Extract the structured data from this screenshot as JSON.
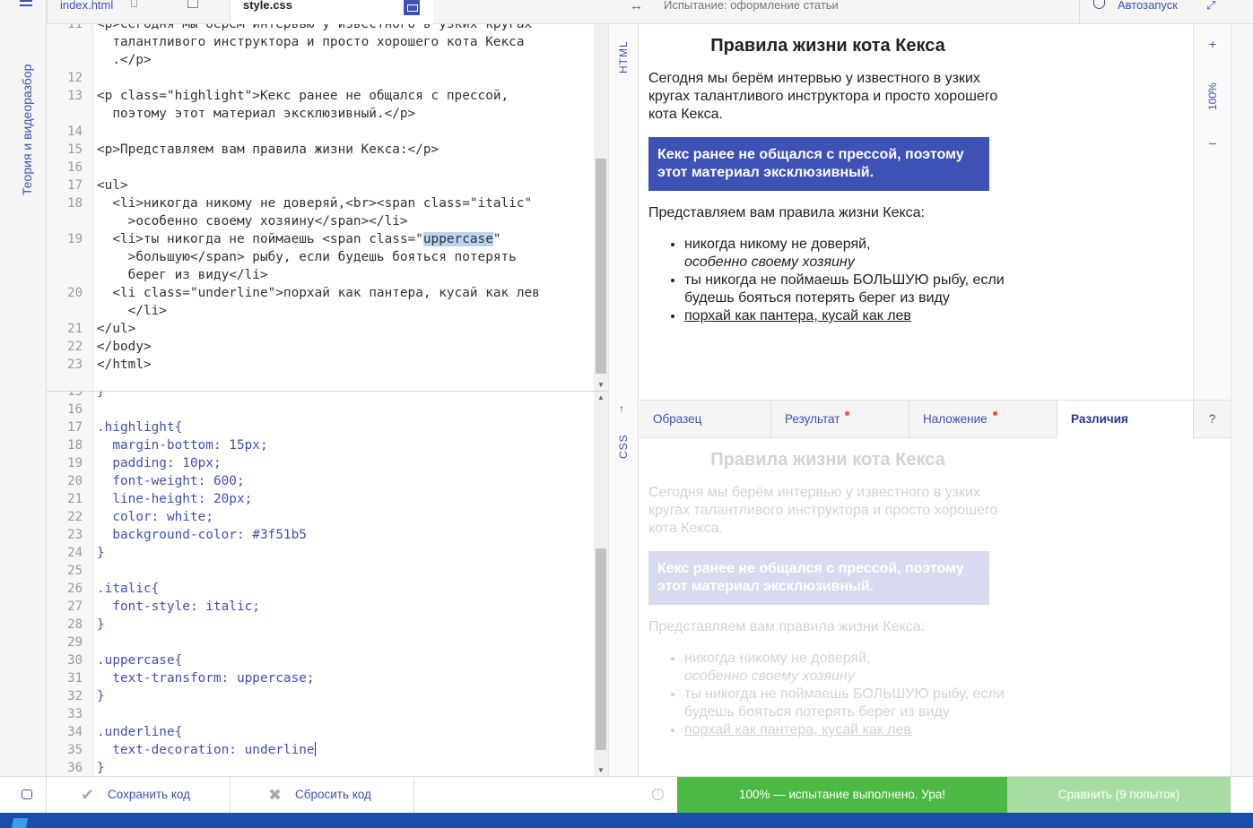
{
  "sidebar": {
    "label": "Теория и видеоразбор"
  },
  "editor_tabs": {
    "index": "index.html",
    "style": "style.css"
  },
  "html_editor": {
    "label": "HTML",
    "lines": [
      {
        "n": "11",
        "t": "<p>Сегодня мы берём интервью у известного в узких кругах"
      },
      {
        "n": "",
        "t": "  талантливого инструктора и просто хорошего кота Кекса"
      },
      {
        "n": "",
        "t": "  .</p>"
      },
      {
        "n": "12",
        "t": ""
      },
      {
        "n": "13",
        "t": "<p class=\"highlight\">Кекс ранее не общался с прессой,"
      },
      {
        "n": "",
        "t": "  поэтому этот материал эксклюзивный.</p>"
      },
      {
        "n": "14",
        "t": ""
      },
      {
        "n": "15",
        "t": "<p>Представляем вам правила жизни Кекса:</p>"
      },
      {
        "n": "16",
        "t": ""
      },
      {
        "n": "17",
        "t": "<ul>"
      },
      {
        "n": "18",
        "t": "  <li>никогда никому не доверяй,<br><span class=\"italic\""
      },
      {
        "n": "",
        "t": "    >особенно своему хозяину</span></li>"
      },
      {
        "n": "19",
        "t": "  <li>ты никогда не поймаешь <span class=\"",
        "hl": "uppercase",
        "after": "\""
      },
      {
        "n": "",
        "t": "    >большую</span> рыбу, если будешь бояться потерять"
      },
      {
        "n": "",
        "t": "    берег из виду</li>"
      },
      {
        "n": "20",
        "t": "  <li class=\"underline\">порхай как пантера, кусай как лев"
      },
      {
        "n": "",
        "t": "    </li>"
      },
      {
        "n": "21",
        "t": "</ul>"
      },
      {
        "n": "22",
        "t": "</body>"
      },
      {
        "n": "23",
        "t": "</html>"
      }
    ]
  },
  "css_editor": {
    "label": "CSS",
    "lines": [
      {
        "n": "15",
        "t": "}"
      },
      {
        "n": "16",
        "t": ""
      },
      {
        "n": "17",
        "t": ".highlight{"
      },
      {
        "n": "18",
        "t": "  margin-bottom: 15px;"
      },
      {
        "n": "19",
        "t": "  padding: 10px;"
      },
      {
        "n": "20",
        "t": "  font-weight: 600;"
      },
      {
        "n": "21",
        "t": "  line-height: 20px;"
      },
      {
        "n": "22",
        "t": "  color: white;"
      },
      {
        "n": "23",
        "t": "  background-color: #3f51b5"
      },
      {
        "n": "24",
        "t": "}"
      },
      {
        "n": "25",
        "t": ""
      },
      {
        "n": "26",
        "t": ".italic{"
      },
      {
        "n": "27",
        "t": "  font-style: italic;"
      },
      {
        "n": "28",
        "t": "}"
      },
      {
        "n": "29",
        "t": ""
      },
      {
        "n": "30",
        "t": ".uppercase{"
      },
      {
        "n": "31",
        "t": "  text-transform: uppercase;"
      },
      {
        "n": "32",
        "t": "}"
      },
      {
        "n": "33",
        "t": ""
      },
      {
        "n": "34",
        "t": ".underline{"
      },
      {
        "n": "35",
        "t": "  text-decoration: underline",
        "cursor": true
      },
      {
        "n": "36",
        "t": "}"
      }
    ]
  },
  "right_bar": {
    "title": "Испытание: оформление статьи",
    "autorun": "Автозапуск"
  },
  "zoom": {
    "plus": "+",
    "level": "100%",
    "minus": "–"
  },
  "article": {
    "title": "Правила жизни кота Кекса",
    "intro": "Сегодня мы берём интервью у известного в узких кругах талантливого инструктора и просто хорошего кота Кекса.",
    "highlight": "Кекс ранее не общался с прессой, поэтому этот материал эксклюзивный.",
    "lead": "Представляем вам правила жизни Кекса:",
    "rule1": "никогда никому не доверяй,",
    "rule1_italic": "особенно своему хозяину",
    "rule2_before": "ты никогда не поймаешь ",
    "rule2_upper": "большую",
    "rule2_after": " рыбу, если будешь бояться потерять берег из виду",
    "rule3": "порхай как пантера, кусай как лев"
  },
  "compare_tabs": {
    "sample": "Образец",
    "result": "Результат",
    "overlay": "Наложение",
    "diff": "Различия",
    "help": "?"
  },
  "bottom": {
    "save": "Сохранить код",
    "reset": "Сбросить код",
    "status": "100% — испытание выполнено. Ура!",
    "compare": "Сравнить (9 попыток)"
  },
  "colors": {
    "accent": "#3f51b5",
    "success": "#4cb944",
    "success_light": "#a7dca2",
    "dot": "#e8572b"
  }
}
